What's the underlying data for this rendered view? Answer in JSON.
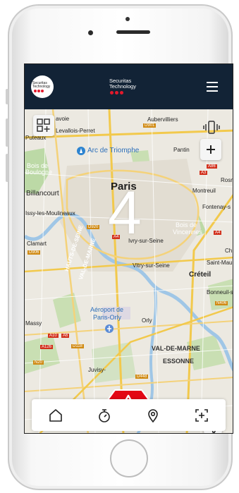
{
  "app": {
    "logo_text": "Securitas Technology",
    "brand_line1": "Securitas",
    "brand_line2": "Technology",
    "accent_color": "#e3192b",
    "header_color": "#122336"
  },
  "map": {
    "labels": {
      "auberviliers": "Aubervilliers",
      "levallois": "Levallois-Perret",
      "puteaux": "Puteaux",
      "colombes": "avoie",
      "arc": "Arc de Triomphe",
      "pantin": "Pantin",
      "bois_boulogne_1": "Bois de",
      "bois_boulogne_2": "Boulogne",
      "rosny": "Rosn",
      "paris": "Paris",
      "montreuil": "Montreuil",
      "billancourt": "Billancourt",
      "fontenay": "Fontenay-s",
      "issy": "Issy-les-Moulineaux",
      "vincennes_1": "Bois de",
      "vincennes_2": "Vincennes",
      "ivry": "Ivry-sur-Seine",
      "clamart": "Clamart",
      "hauts_de_seine": "HAUTS-DE-SEINE",
      "val_de_marne": "VAL-DE-MARNE",
      "vitry": "Vitry-sur-Seine",
      "saint_maur": "Saint-Maur-d",
      "creteil": "Créteil",
      "bonneuil": "Bonneuil-su",
      "aeroport_1": "Aéroport de",
      "aeroport_2": "Paris-Orly",
      "massy": "Massy",
      "orly": "Orly",
      "val_de_marne_2": "VAL-DE-MARNE",
      "essonne": "ESSONNE",
      "juvisy": "Juvisy-",
      "cho": "Ch"
    },
    "road_badges": [
      "D901",
      "A86",
      "A3",
      "A4",
      "D920",
      "A4",
      "D906",
      "N406",
      "A10",
      "A6",
      "D118",
      "N20",
      "A126",
      "D448",
      "A86",
      "A86",
      "A4"
    ]
  },
  "counter": "4",
  "icons": {
    "grid": "grid-add-icon",
    "vibrate": "phone-vibrate-icon",
    "zoom_in": "plus-icon",
    "alert": "warning-triangle-icon",
    "locate": "navigation-arrow-icon",
    "menu": "hamburger-menu-icon"
  },
  "bottom_nav": [
    {
      "name": "home",
      "icon": "home-icon"
    },
    {
      "name": "timer",
      "icon": "stopwatch-icon"
    },
    {
      "name": "location",
      "icon": "map-pin-icon"
    },
    {
      "name": "scan",
      "icon": "scan-plus-icon"
    }
  ]
}
